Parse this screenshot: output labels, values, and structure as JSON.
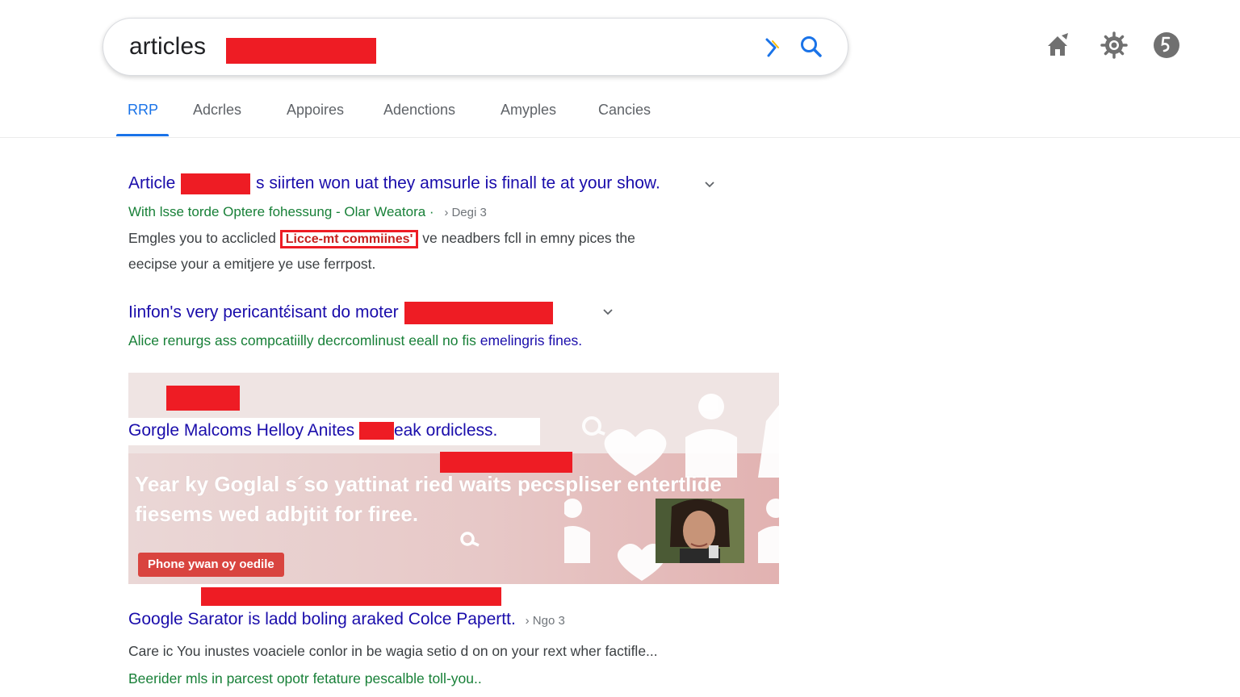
{
  "search": {
    "query": "articles"
  },
  "tabs": [
    {
      "label": "RRP",
      "active": true
    },
    {
      "label": "Adcrles"
    },
    {
      "label": "Appoires"
    },
    {
      "label": "Adenctions"
    },
    {
      "label": "Amyples"
    },
    {
      "label": "Cancies"
    }
  ],
  "results": [
    {
      "title_pre": "Article",
      "title_post": "s siirten won uat they amsurle is finall te at your show.",
      "url": "With lsse torde Optere fohessung - Olar Weatora ·",
      "meta": "› Degi 3",
      "snippet1_pre": "Emgles you to acclicled",
      "snippet1_boxed": "Licce-mt commiines'",
      "snippet1_post": "ve neadbers fcll in emny pices the",
      "snippet2": "eecipse your a emitjere ye use ferrpost."
    },
    {
      "title": "Iinfon's very pericantɛ́isant do moter",
      "url_green": "Alice renurgs ass compcatiilly decrcomlinust eeall no fis ",
      "url_blue": "emelingris fines."
    },
    {
      "title_pre": "Google Sarator is ladd boling araked Colce Papertt.",
      "meta": "› Ngo 3",
      "snippet": "Care ic You inustes voaciele conlor in be wagia setio d on on your rext wher factifle...",
      "url": "Beerider mls in parcest opotr fetature pescalble toll-you.."
    }
  ],
  "banner": {
    "label_pre": "Gorgle Malcoms Helloy Anites",
    "label_post": "eak ordicless.",
    "headline": "Year ky Goglal s´so yattinat ried waits pecspliser entertlide fiesems wed adbjtit for firee.",
    "button": "Phone ywan oy oedile"
  },
  "colors": {
    "link": "#1a0dab",
    "url_green": "#188038",
    "accent_blue": "#1a73e8",
    "redaction": "#ee1c24"
  }
}
